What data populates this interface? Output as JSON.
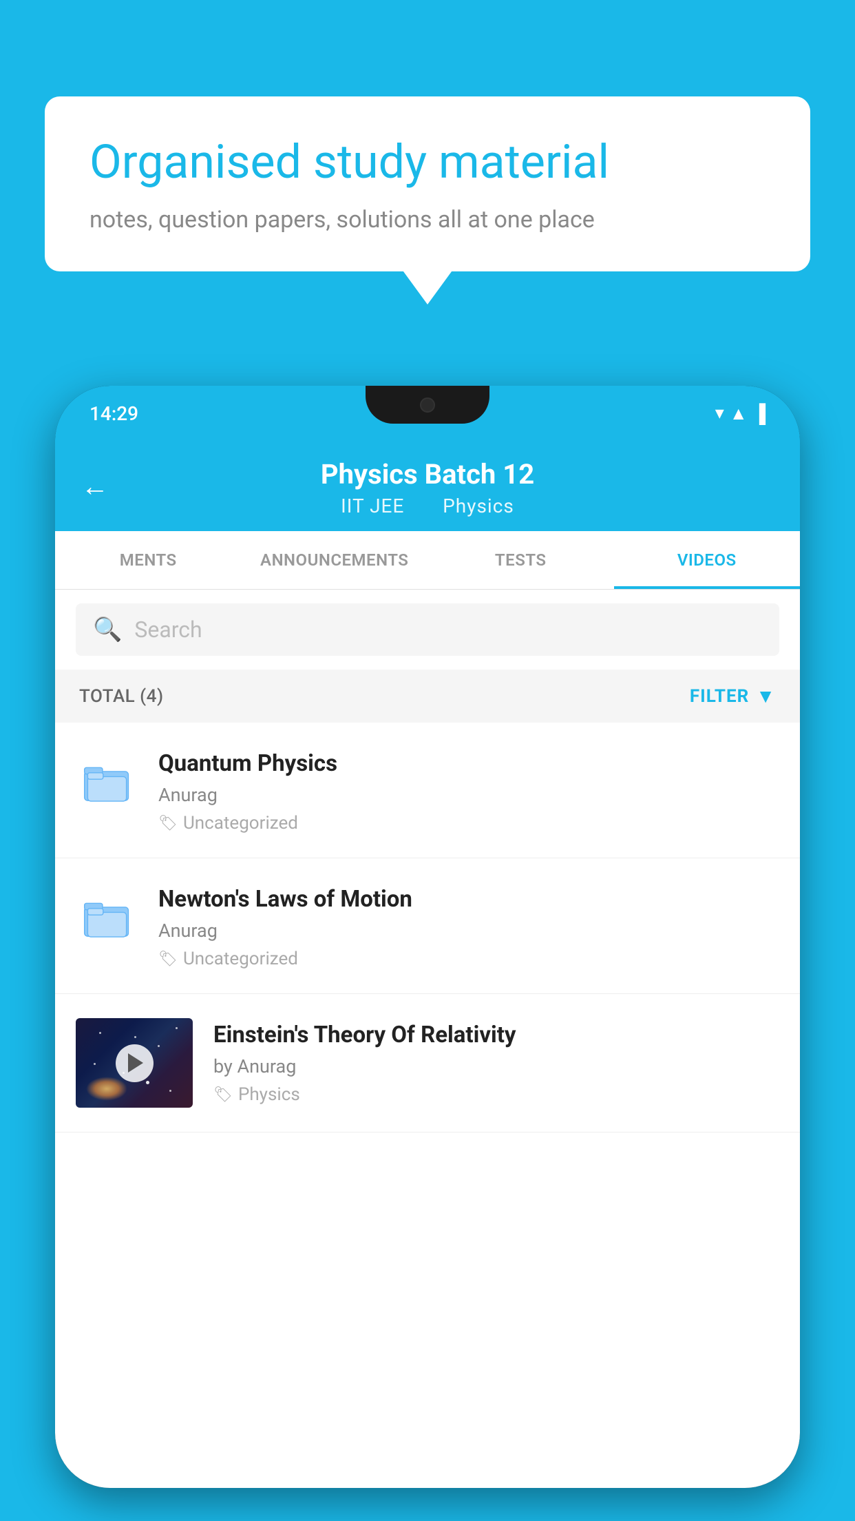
{
  "background_color": "#1ab8e8",
  "speech_bubble": {
    "title": "Organised study material",
    "subtitle": "notes, question papers, solutions all at one place"
  },
  "phone": {
    "status_bar": {
      "time": "14:29"
    },
    "header": {
      "back_label": "←",
      "title": "Physics Batch 12",
      "subtitle_left": "IIT JEE",
      "subtitle_right": "Physics"
    },
    "tabs": [
      {
        "label": "MENTS",
        "active": false
      },
      {
        "label": "ANNOUNCEMENTS",
        "active": false
      },
      {
        "label": "TESTS",
        "active": false
      },
      {
        "label": "VIDEOS",
        "active": true
      }
    ],
    "search": {
      "placeholder": "Search"
    },
    "filter_bar": {
      "total_label": "TOTAL (4)",
      "filter_label": "FILTER"
    },
    "videos": [
      {
        "id": 1,
        "type": "folder",
        "title": "Quantum Physics",
        "author": "Anurag",
        "tag": "Uncategorized"
      },
      {
        "id": 2,
        "type": "folder",
        "title": "Newton's Laws of Motion",
        "author": "Anurag",
        "tag": "Uncategorized"
      },
      {
        "id": 3,
        "type": "video",
        "title": "Einstein's Theory Of Relativity",
        "author": "by Anurag",
        "tag": "Physics"
      }
    ]
  }
}
